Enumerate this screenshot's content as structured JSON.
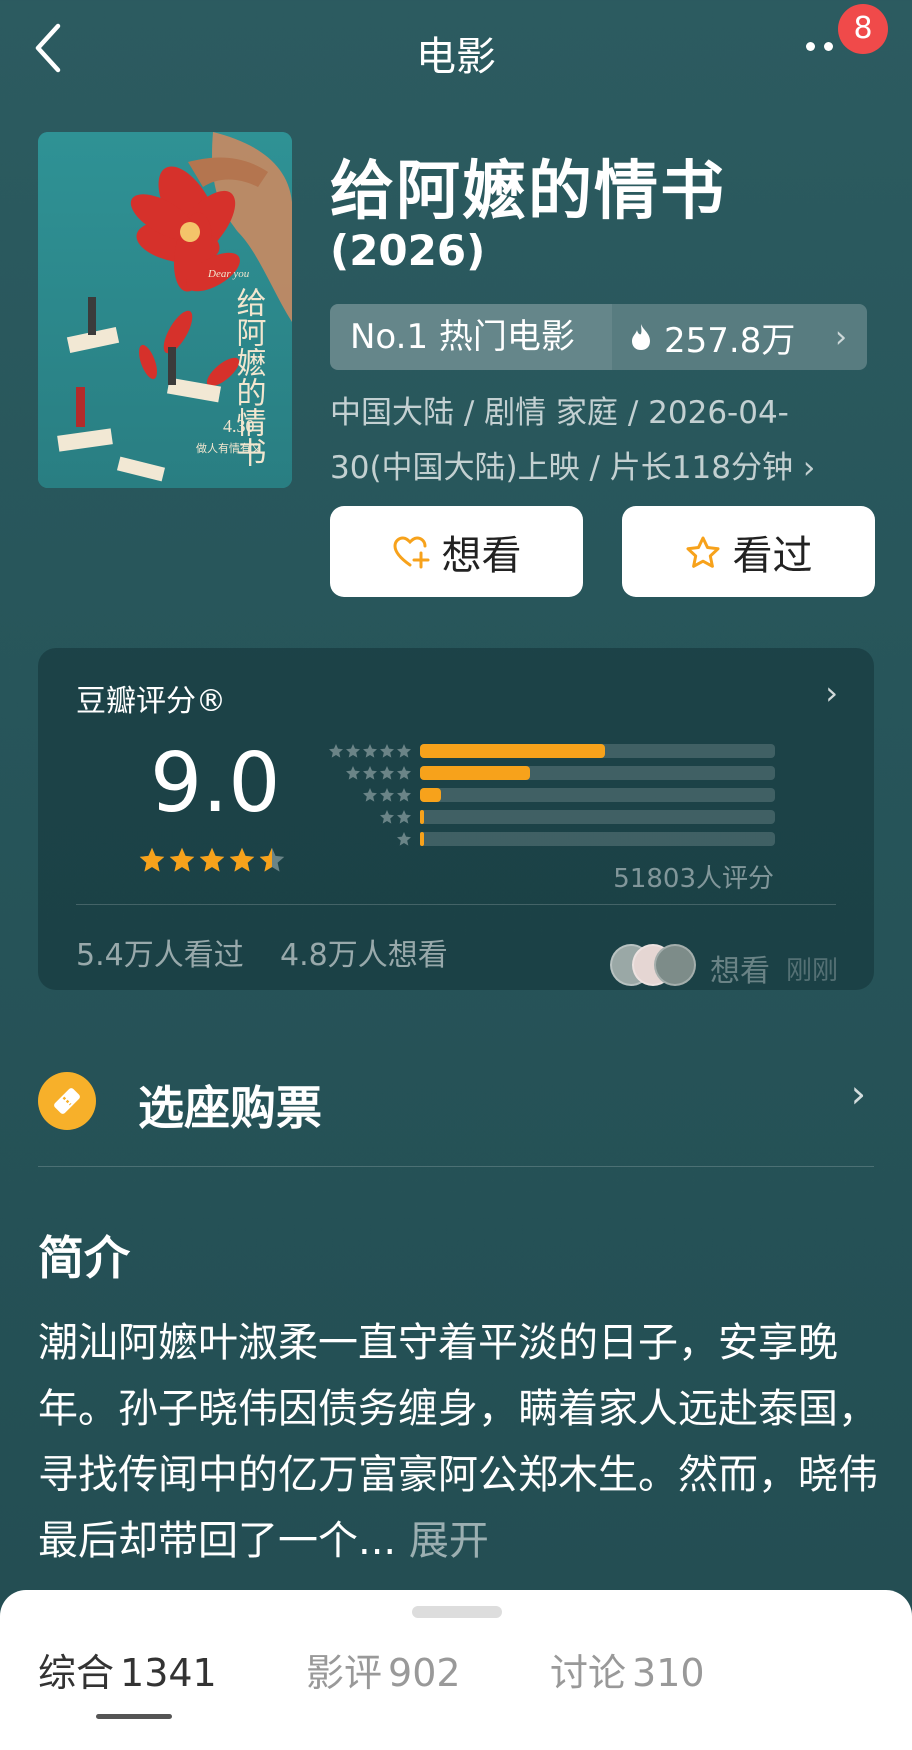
{
  "header": {
    "title": "电影",
    "badge_count": "8"
  },
  "movie": {
    "title": "给阿嬷的情书",
    "year": "(2026)",
    "rank_label": "No.1 热门电影",
    "heat": "257.8万",
    "meta": "中国大陆 / 剧情 家庭 / 2026-04-30(中国大陆)上映 / 片长118分钟"
  },
  "poster": {
    "title_text": "给阿嬷的情书",
    "date_text": "4.30",
    "tagline_text": "做人有情有义",
    "dear_text": "Dear you"
  },
  "actions": {
    "want_label": "想看",
    "seen_label": "看过"
  },
  "rating": {
    "title": "豆瓣评分®",
    "score": "9.0",
    "stars_value": 4.5,
    "distribution": [
      {
        "stars": 5,
        "fraction": 0.52
      },
      {
        "stars": 4,
        "fraction": 0.31
      },
      {
        "stars": 3,
        "fraction": 0.06
      },
      {
        "stars": 2,
        "fraction": 0.01
      },
      {
        "stars": 1,
        "fraction": 0.01
      }
    ],
    "count_text": "51803人评分",
    "watched_text": "5.4万人看过",
    "wish_text": "4.8万人想看",
    "activity_action": "想看",
    "activity_time": "刚刚"
  },
  "ticket": {
    "label": "选座购票"
  },
  "intro": {
    "title": "简介",
    "text": "潮汕阿嬷叶淑柔一直守着平淡的日子，安享晚年。孙子晓伟因债务缠身，瞒着家人远赴泰国，寻找传闻中的亿万富豪阿公郑木生。然而，晓伟最后却带回了一个...",
    "expand_label": " 展开"
  },
  "tabs": [
    {
      "label": "综合",
      "count": "1341"
    },
    {
      "label": "影评",
      "count": "902"
    },
    {
      "label": "讨论",
      "count": "310"
    }
  ],
  "colors": {
    "accent": "#f7a21b",
    "badge": "#f04a4a",
    "background": "#2a585d"
  }
}
